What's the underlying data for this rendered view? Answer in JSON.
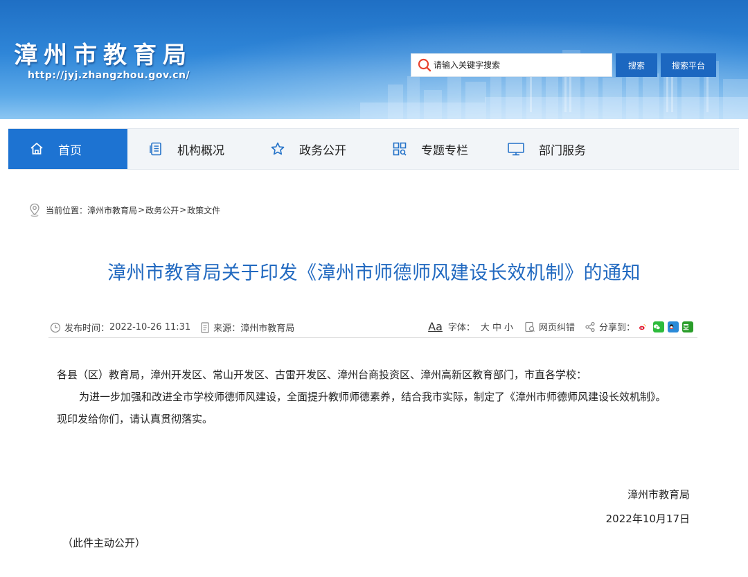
{
  "header": {
    "site_title": "漳州市教育局",
    "site_url": "http://jyj.zhangzhou.gov.cn/",
    "search_placeholder": "请输入关键字搜索",
    "search_button": "搜索",
    "platform_button": "搜索平台"
  },
  "nav": {
    "items": [
      {
        "label": "首页",
        "icon": "home-icon",
        "active": true
      },
      {
        "label": "机构概况",
        "icon": "document-list-icon"
      },
      {
        "label": "政务公开",
        "icon": "star-icon"
      },
      {
        "label": "专题专栏",
        "icon": "grid-search-icon"
      },
      {
        "label": "部门服务",
        "icon": "monitor-icon"
      }
    ]
  },
  "breadcrumb": {
    "prefix": "当前位置：",
    "items": [
      "漳州市教育局",
      "政务公开",
      "政策文件"
    ],
    "separator": ">"
  },
  "article": {
    "title": "漳州市教育局关于印发《漳州市师德师风建设长效机制》的通知",
    "publish_label": "发布时间：",
    "publish_time": "2022-10-26 11:31",
    "source_label": "来源：",
    "source": "漳州市教育局",
    "font_aa": "Aa",
    "font_label": "字体：",
    "font_large": "大",
    "font_medium": "中",
    "font_small": "小",
    "correction": "网页纠错",
    "share_label": "分享到：",
    "share_targets": [
      "weibo-icon",
      "wechat-icon",
      "qq-icon",
      "douban-icon"
    ],
    "addressee": "各县（区）教育局，漳州开发区、常山开发区、古雷开发区、漳州台商投资区、漳州高新区教育部门，市直各学校：",
    "paragraph": "为进一步加强和改进全市学校师德师风建设，全面提升教师师德素养，结合我市实际，制定了《漳州市师德师风建设长效机制》。现印发给你们，请认真贯彻落实。",
    "signature_org": "漳州市教育局",
    "signature_date": "2022年10月17日",
    "note": "（此件主动公开）"
  },
  "colors": {
    "brand_blue": "#1d73d2",
    "title_blue": "#2169c0",
    "search_icon_red": "#e8432e",
    "weibo": "#e6162d",
    "wechat": "#2dbb3c",
    "qq": "#2b8ad8",
    "douban": "#2a9d2a"
  }
}
